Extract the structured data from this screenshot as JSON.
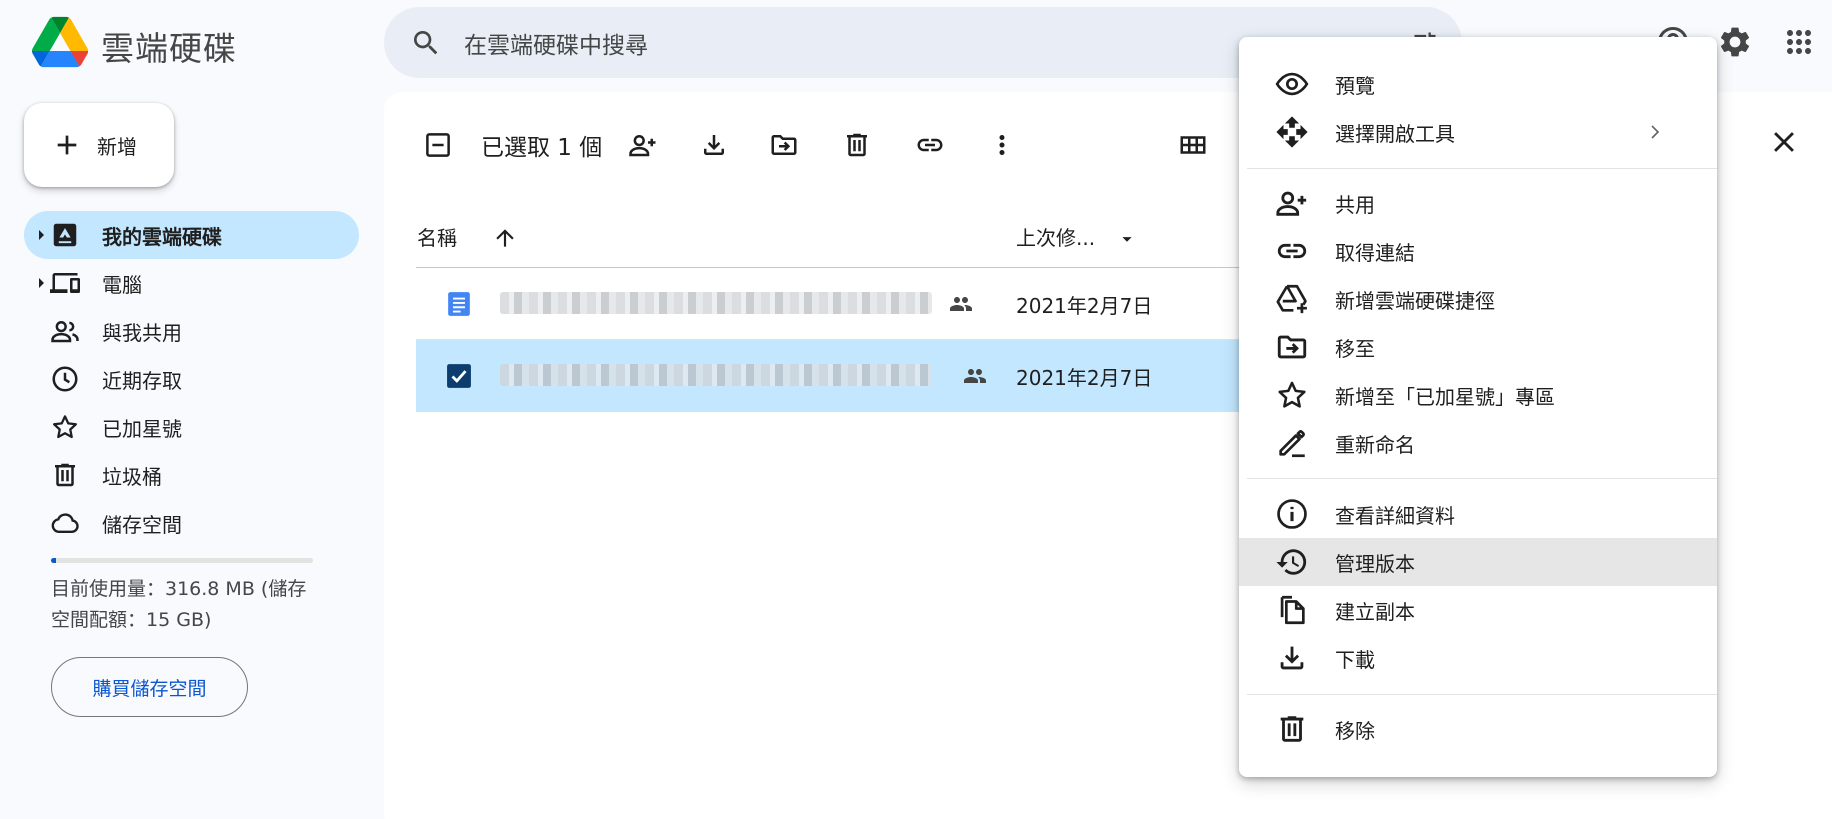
{
  "app": {
    "title": "雲端硬碟"
  },
  "search": {
    "placeholder": "在雲端硬碟中搜尋"
  },
  "new_button": {
    "label": "新增"
  },
  "sidebar": {
    "items": [
      {
        "label": "我的雲端硬碟",
        "icon": "my-drive-icon",
        "active": true,
        "expandable": true
      },
      {
        "label": "電腦",
        "icon": "computers-icon",
        "active": false,
        "expandable": true
      },
      {
        "label": "與我共用",
        "icon": "shared-with-me-icon",
        "active": false,
        "expandable": false
      },
      {
        "label": "近期存取",
        "icon": "recent-icon",
        "active": false,
        "expandable": false
      },
      {
        "label": "已加星號",
        "icon": "star-icon",
        "active": false,
        "expandable": false
      },
      {
        "label": "垃圾桶",
        "icon": "trash-icon",
        "active": false,
        "expandable": false
      },
      {
        "label": "儲存空間",
        "icon": "cloud-icon",
        "active": false,
        "expandable": false
      }
    ]
  },
  "storage": {
    "usage_text": "目前使用量：316.8 MB (儲存空間配額：15 GB)",
    "used_fraction": 0.02,
    "buy_label": "購買儲存空間"
  },
  "toolbar": {
    "selection_text": "已選取 1 個"
  },
  "file_list": {
    "columns": {
      "name": "名稱",
      "modified": "上次修..."
    },
    "rows": [
      {
        "type": "document",
        "shared": true,
        "modified": "2021年2月7日",
        "selected": false
      },
      {
        "type": "document",
        "shared": true,
        "modified": "2021年2月7日",
        "selected": true
      }
    ]
  },
  "context_menu": {
    "items": [
      {
        "label": "預覽",
        "icon": "eye-icon"
      },
      {
        "label": "選擇開啟工具",
        "icon": "open-with-icon",
        "submenu": true
      },
      {
        "label": "共用",
        "icon": "share-person-icon"
      },
      {
        "label": "取得連結",
        "icon": "link-icon"
      },
      {
        "label": "新增雲端硬碟捷徑",
        "icon": "drive-shortcut-icon"
      },
      {
        "label": "移至",
        "icon": "move-folder-icon"
      },
      {
        "label": "新增至「已加星號」專區",
        "icon": "star-icon"
      },
      {
        "label": "重新命名",
        "icon": "rename-icon"
      },
      {
        "label": "查看詳細資料",
        "icon": "info-icon"
      },
      {
        "label": "管理版本",
        "icon": "history-icon",
        "hover": true
      },
      {
        "label": "建立副本",
        "icon": "copy-icon"
      },
      {
        "label": "下載",
        "icon": "download-icon"
      },
      {
        "label": "移除",
        "icon": "trash-icon"
      }
    ]
  },
  "colors": {
    "accent": "#0b57d0",
    "selected_bg": "#c2e7ff",
    "search_bg": "#e9eef6",
    "page_bg": "#f8fafd"
  }
}
